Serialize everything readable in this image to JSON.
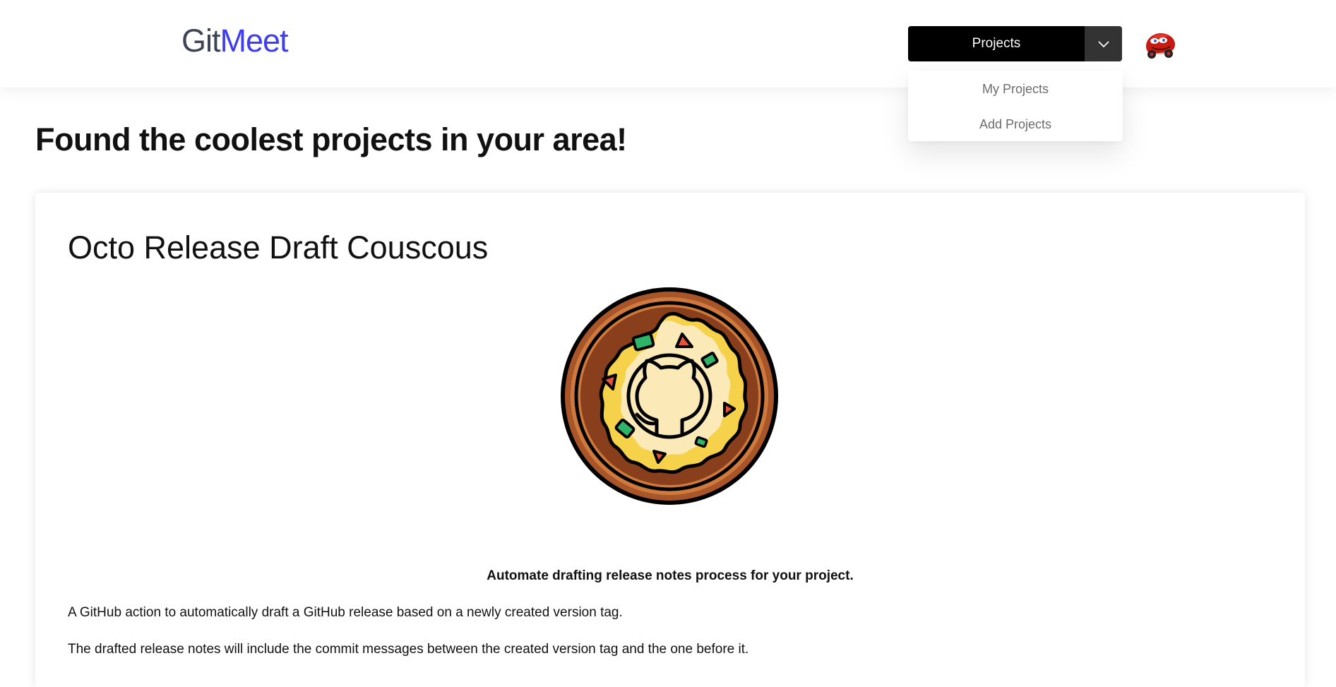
{
  "header": {
    "logo_part1": "Git",
    "logo_part2": "Meet",
    "projects_button_label": "Projects",
    "dropdown": {
      "items": [
        {
          "label": "My Projects"
        },
        {
          "label": "Add Projects"
        }
      ]
    },
    "avatar_icon": "red-cartoon-car-avatar"
  },
  "main": {
    "page_title": "Found the coolest projects in your area!",
    "project": {
      "title": "Octo Release Draft Couscous",
      "image_icon": "octocat-couscous-plate",
      "tagline": "Automate drafting release notes process for your project.",
      "paragraphs": [
        "A GitHub action to automatically draft a GitHub release based on a newly created version tag.",
        "The drafted release notes will include the commit messages between the created version tag and the one before it."
      ]
    }
  },
  "colors": {
    "logo_git": "#3e4356",
    "logo_meet": "#3f3df0",
    "button_bg": "#000000",
    "button_toggle_bg": "#333333"
  }
}
